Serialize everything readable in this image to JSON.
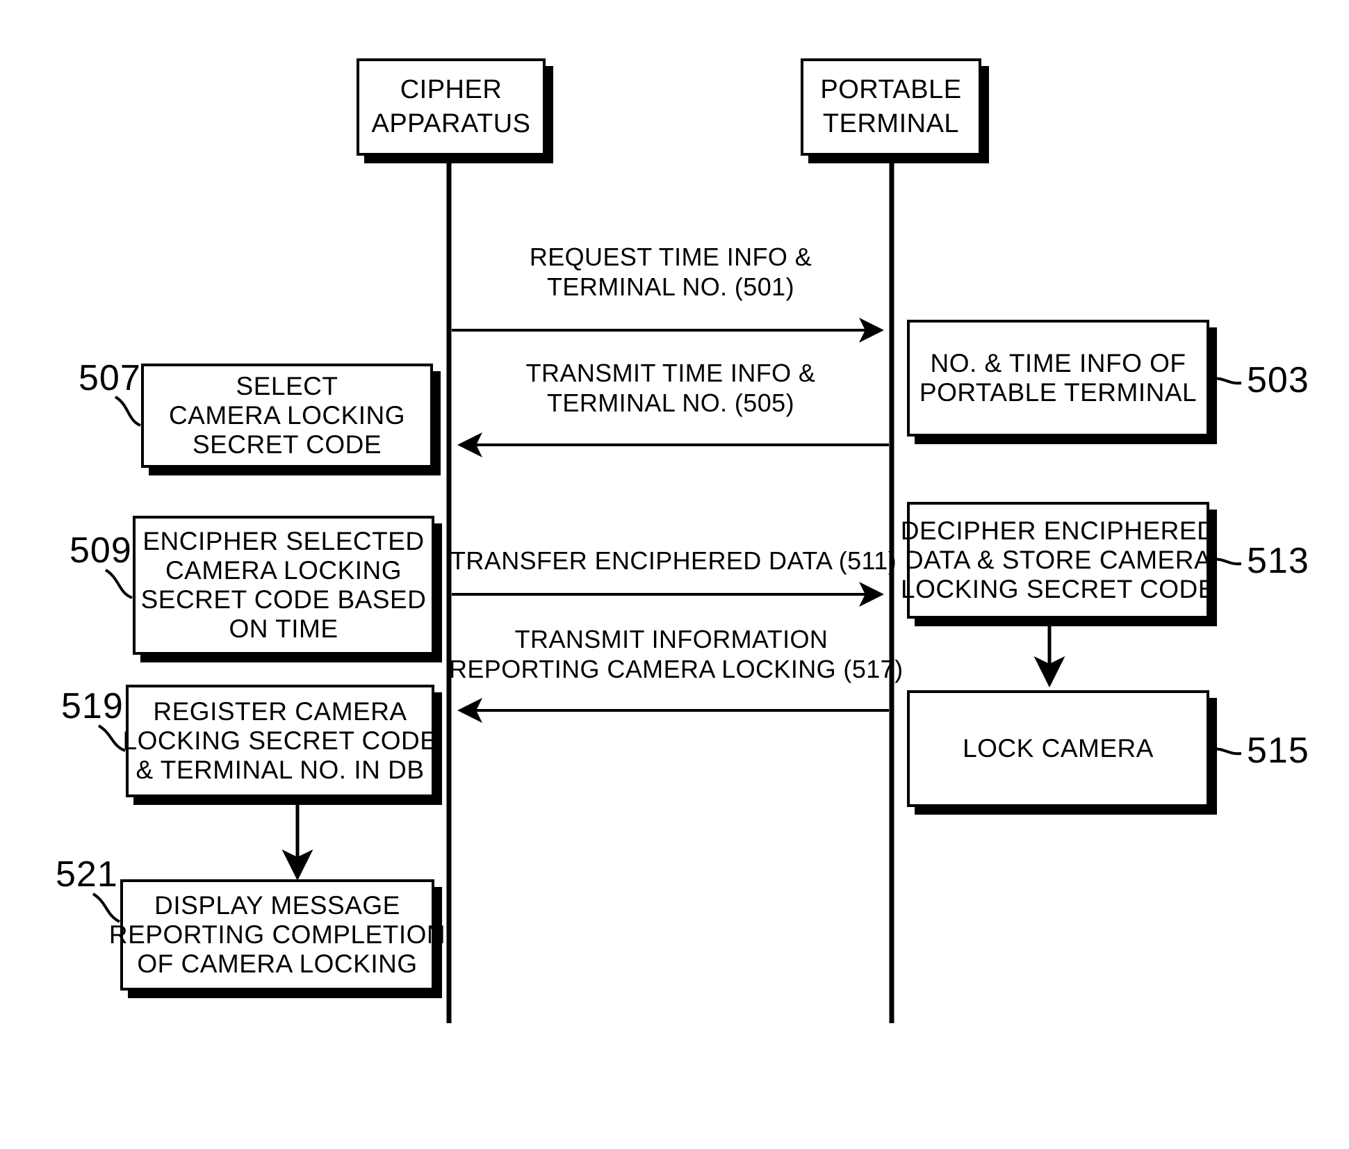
{
  "figure": {
    "type": "patent-sequence-diagram",
    "background_color": "#ffffff",
    "ink_color": "#000000"
  },
  "actors": [
    {
      "id": "cipher-apparatus",
      "lines": [
        "CIPHER",
        "APPARATUS"
      ]
    },
    {
      "id": "portable-terminal",
      "lines": [
        "PORTABLE",
        "TERMINAL"
      ]
    }
  ],
  "steps": [
    {
      "ref": "503",
      "side": "right",
      "lines": [
        "NO. & TIME INFO OF",
        "PORTABLE TERMINAL"
      ]
    },
    {
      "ref": "507",
      "side": "left",
      "lines": [
        "SELECT",
        "CAMERA LOCKING",
        "SECRET CODE"
      ]
    },
    {
      "ref": "509",
      "side": "left",
      "lines": [
        "ENCIPHER SELECTED",
        "CAMERA LOCKING",
        "SECRET CODE BASED",
        "ON TIME"
      ]
    },
    {
      "ref": "513",
      "side": "right",
      "lines": [
        "DECIPHER ENCIPHERED",
        "DATA & STORE CAMERA",
        "LOCKING SECRET CODE"
      ]
    },
    {
      "ref": "515",
      "side": "right",
      "lines": [
        "LOCK CAMERA"
      ]
    },
    {
      "ref": "519",
      "side": "left",
      "lines": [
        "REGISTER CAMERA",
        "LOCKING SECRET CODE",
        "& TERMINAL NO. IN DB"
      ]
    },
    {
      "ref": "521",
      "side": "left",
      "lines": [
        "DISPLAY MESSAGE",
        "REPORTING COMPLETION",
        "OF CAMERA LOCKING"
      ]
    }
  ],
  "messages": [
    {
      "ref": "501",
      "direction": "right",
      "lines": [
        "REQUEST TIME INFO &",
        "TERMINAL NO. (501)"
      ]
    },
    {
      "ref": "505",
      "direction": "left",
      "lines": [
        "TRANSMIT TIME INFO &",
        "TERMINAL NO. (505)"
      ]
    },
    {
      "ref": "511",
      "direction": "right",
      "lines": [
        "TRANSFER ENCIPHERED DATA (511)"
      ]
    },
    {
      "ref": "517",
      "direction": "left",
      "lines": [
        "TRANSMIT INFORMATION",
        "REPORTING CAMERA LOCKING (517)"
      ]
    }
  ]
}
